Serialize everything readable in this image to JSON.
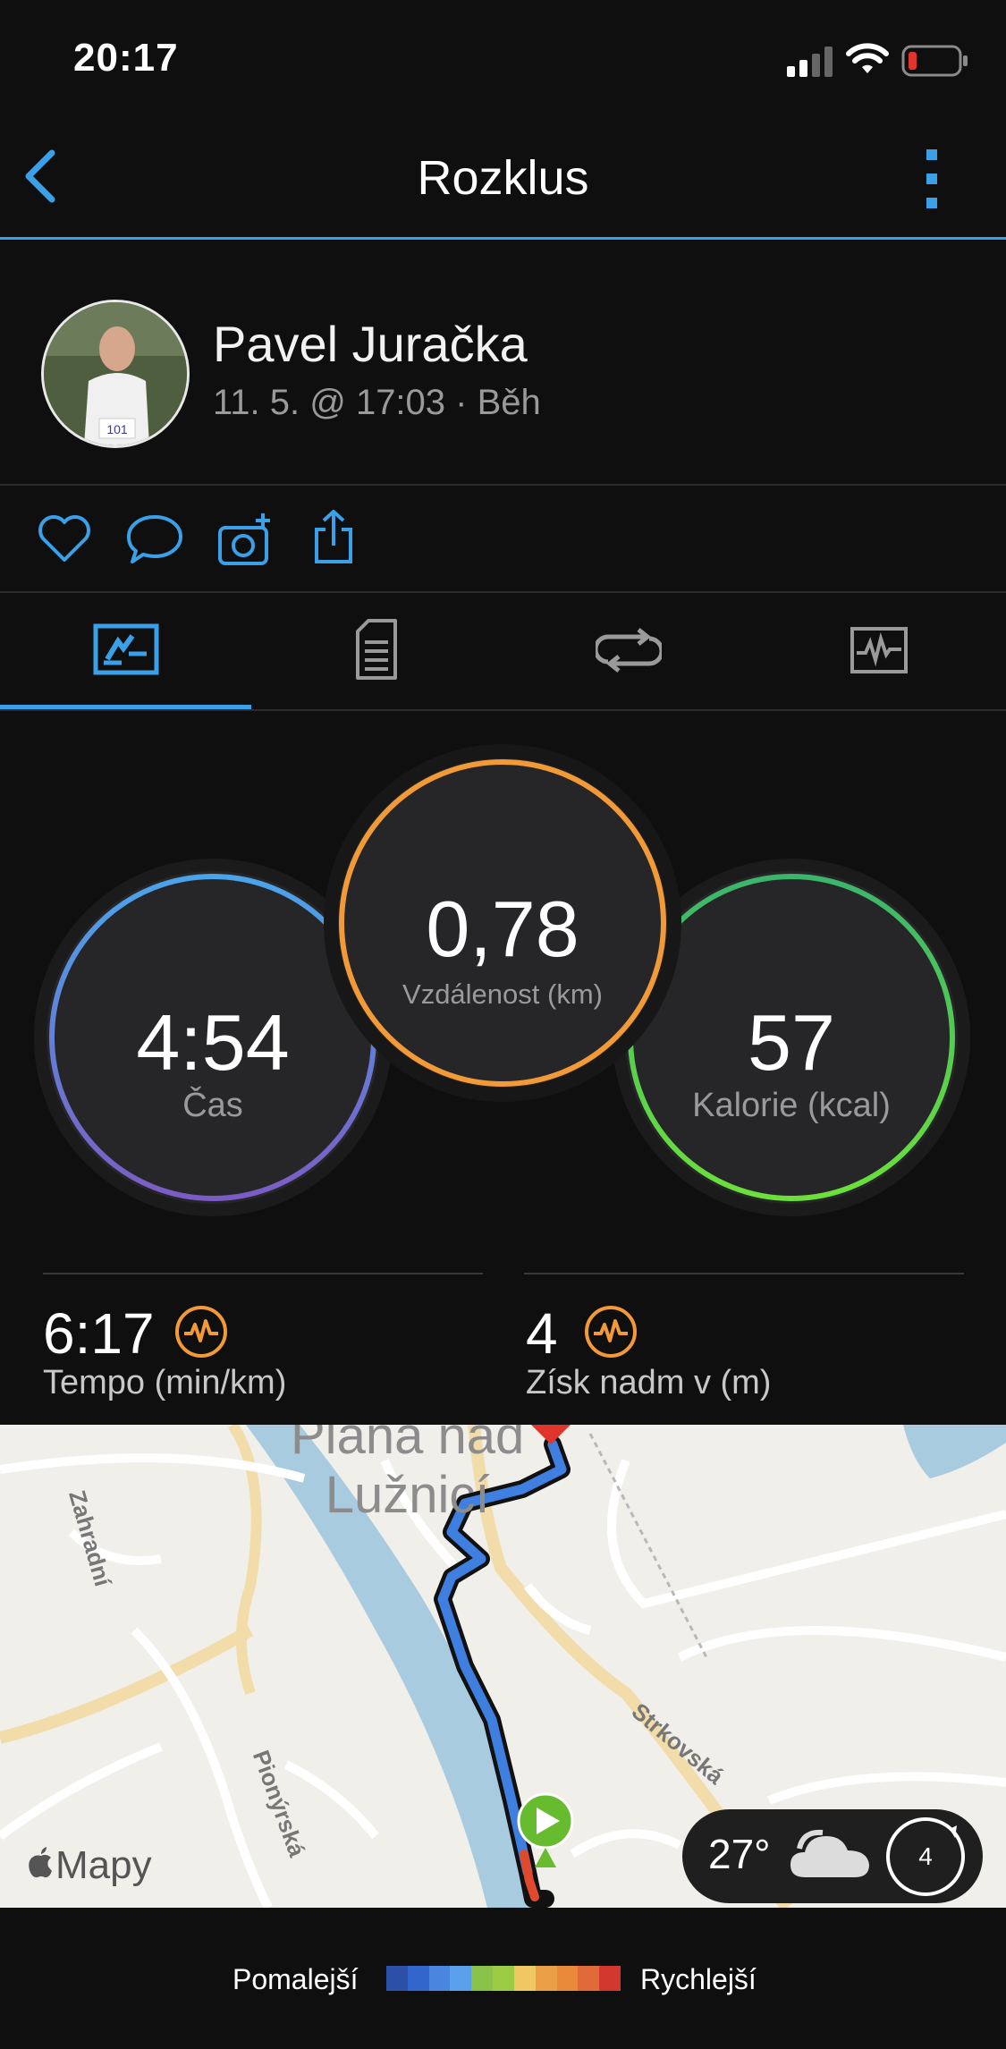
{
  "status_bar": {
    "time": "20:17"
  },
  "nav": {
    "title": "Rozklus"
  },
  "profile": {
    "name": "Pavel Juračka",
    "meta": "11. 5. @ 17:03 · Běh",
    "bib": "101"
  },
  "stats": {
    "time": {
      "value": "4:54",
      "label": "Čas"
    },
    "distance": {
      "value": "0,78",
      "label": "Vzdálenost (km)"
    },
    "calories": {
      "value": "57",
      "label": "Kalorie (kcal)"
    }
  },
  "metrics": {
    "pace": {
      "value": "6:17",
      "label": "Tempo (min/km)"
    },
    "elevation": {
      "value": "4",
      "label": "Získ nadm v (m)"
    }
  },
  "map": {
    "attribution": "Mapy",
    "town": [
      "Planá nad",
      "Lužnicí"
    ],
    "streets": [
      "Zahradní",
      "Pionýrská",
      "Strkovská"
    ],
    "weather": {
      "temperature": "27°",
      "wind": "4"
    }
  },
  "legend": {
    "slower": "Pomalejší",
    "faster": "Rychlejší",
    "colors": [
      "#2c4fa8",
      "#3366cc",
      "#4a86e0",
      "#5aa0ea",
      "#8bc34a",
      "#9ccc44",
      "#f0c862",
      "#eba048",
      "#e88a3a",
      "#e06a38",
      "#d2382e"
    ]
  },
  "colors": {
    "accent": "#3aa0e8",
    "time_ring": "#6f6cd0",
    "distance_ring": "#f29a38",
    "calories_ring": "#55d64a",
    "metric_icon": "#f29a38"
  }
}
